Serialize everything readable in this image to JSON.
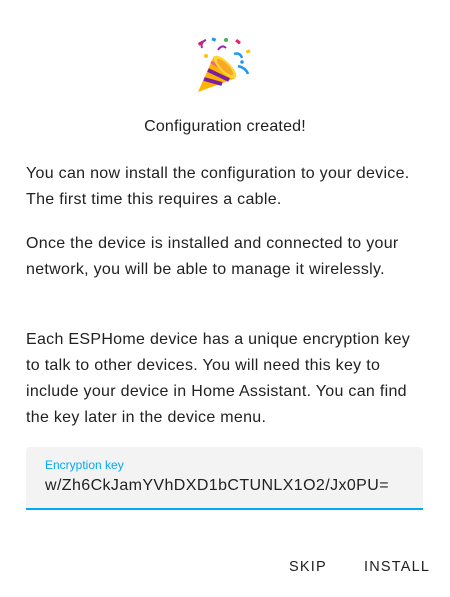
{
  "dialog": {
    "icon": "party-popper-icon",
    "title": "Configuration created!",
    "paragraphs": [
      "You can now install the configuration to your device. The first time this requires a cable.",
      "Once the device is installed and connected to your network, you will be able to manage it wirelessly.",
      "Each ESPHome device has a unique encryption key to talk to other devices. You will need this key to include your device in Home Assistant. You can find the key later in the device menu."
    ],
    "encryption_field": {
      "label": "Encryption key",
      "value": "w/Zh6CkJamYVhDXD1bCTUNLX1O2/Jx0PU="
    },
    "actions": {
      "skip_label": "SKIP",
      "install_label": "INSTALL"
    }
  },
  "colors": {
    "accent": "#03a9f4",
    "text": "#212121",
    "field_bg": "#f3f3f3"
  }
}
